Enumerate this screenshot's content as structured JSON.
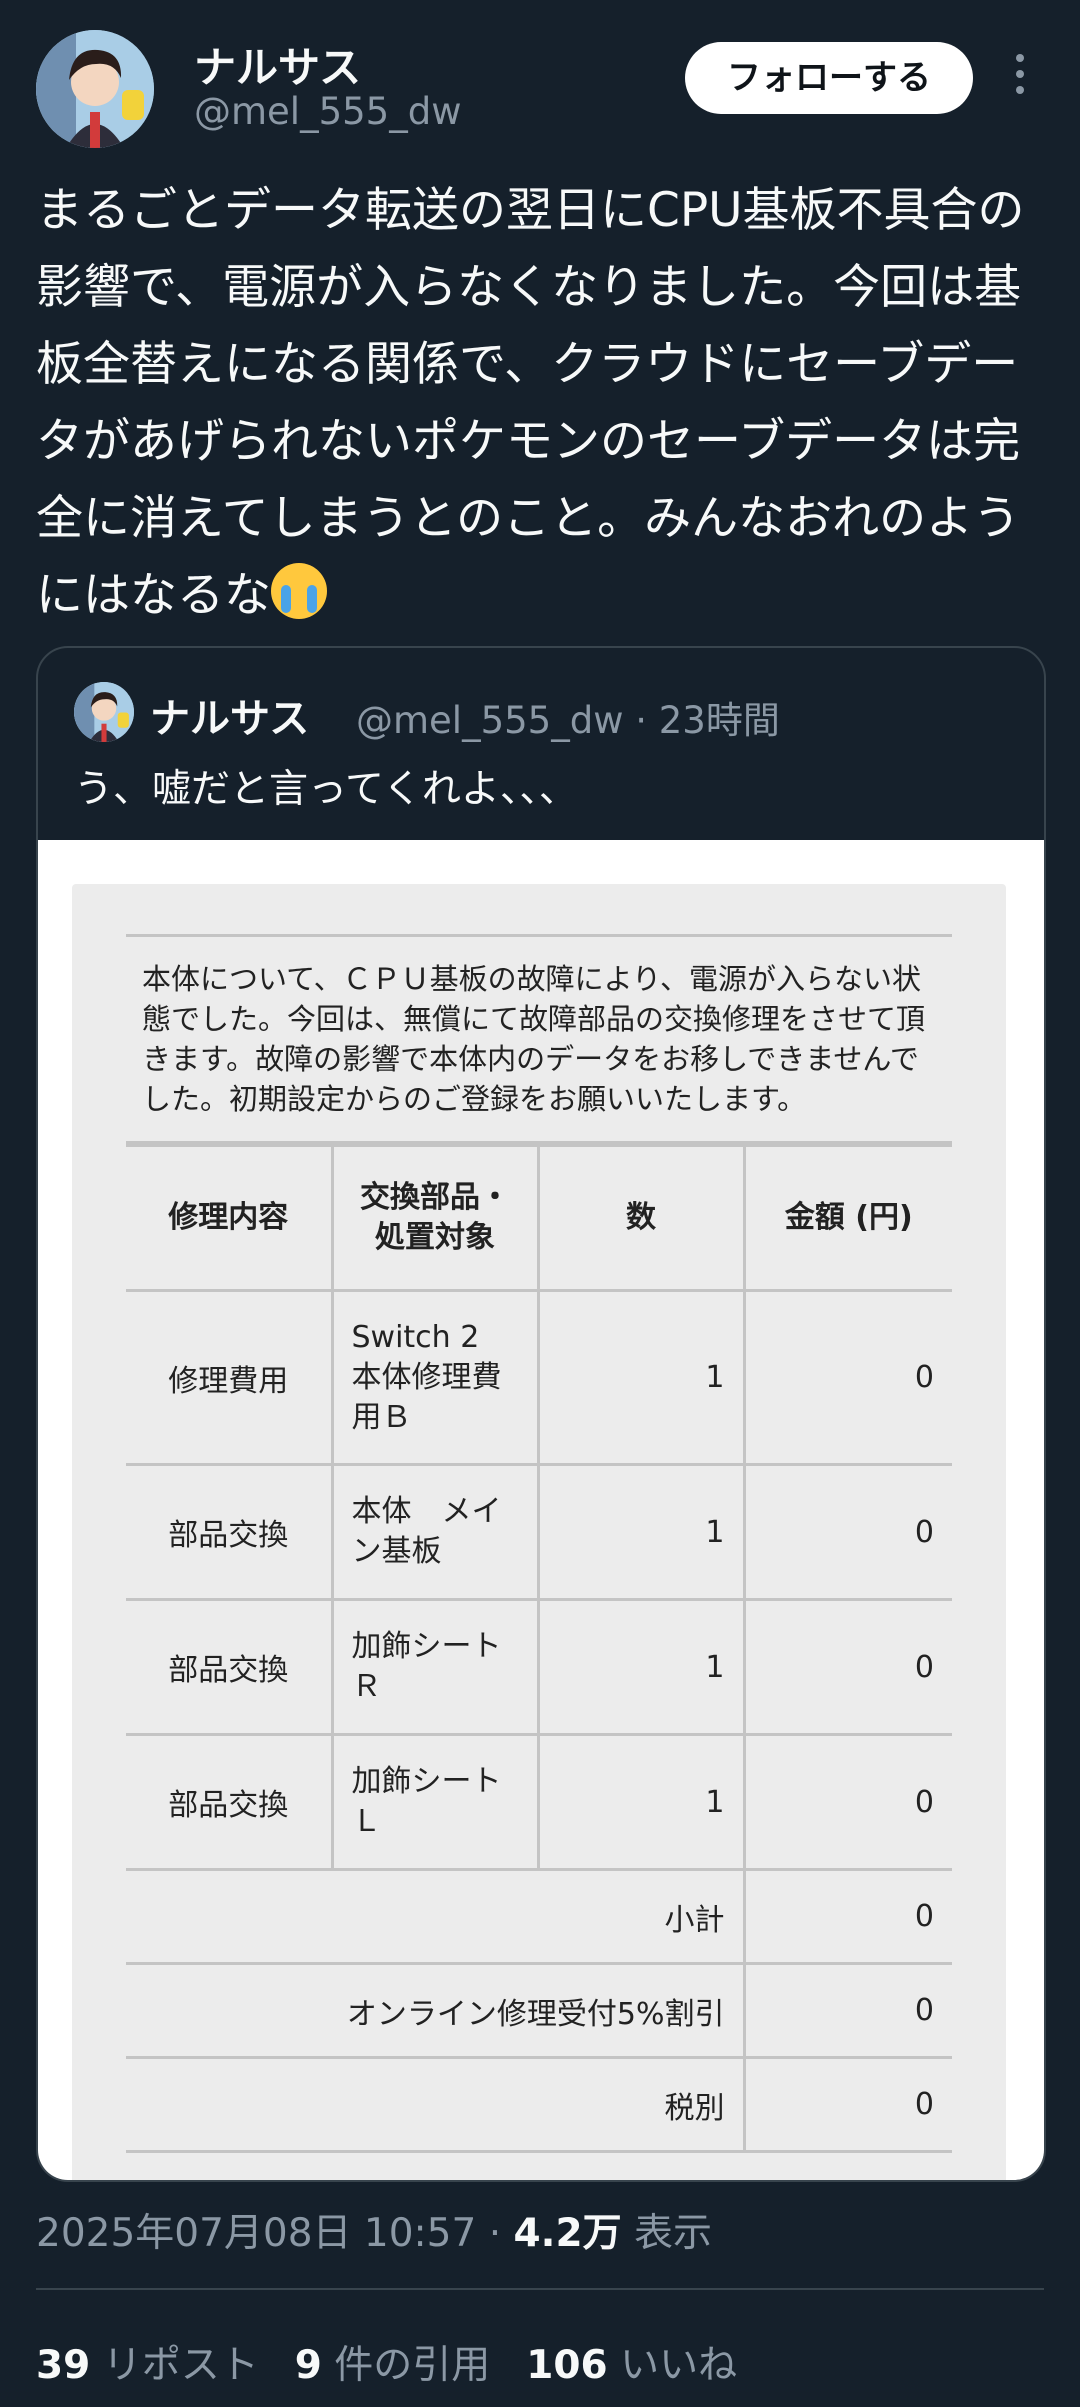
{
  "author": {
    "name": "ナルサス",
    "handle": "@mel_555_dw",
    "follow_label": "フォローする"
  },
  "tweet": {
    "text": "まるごとデータ転送の翌日にCPU基板不具合の影響で、電源が入らなくなりました。今回は基板全替えになる関係で、クラウドにセーブデータがあげられないポケモンのセーブデータは完全に消えてしまうとのこと。みんなおれのようにはなるな",
    "emoji": "loudly-crying-face"
  },
  "quote": {
    "name": "ナルサス",
    "handle_time": "@mel_555_dw · 23時間",
    "text": "う、嘘だと言ってくれよ、、、",
    "document": {
      "notice": "本体について、ＣＰＵ基板の故障により、電源が入らない状態でした。今回は、無償にて故障部品の交換修理をさせて頂きます。故障の影響で本体内のデータをお移しできませんでした。初期設定からのご登録をお願いいたします。",
      "headers": [
        "修理内容",
        "交換部品・処置対象",
        "数",
        "金額 (円)"
      ],
      "rows": [
        {
          "type": "修理費用",
          "part": "Switch 2 本体修理費用Ｂ",
          "qty": "1",
          "amount": "0"
        },
        {
          "type": "部品交換",
          "part": "本体　メイン基板",
          "qty": "1",
          "amount": "0"
        },
        {
          "type": "部品交換",
          "part": "加飾シートＲ",
          "qty": "1",
          "amount": "0"
        },
        {
          "type": "部品交換",
          "part": "加飾シートＬ",
          "qty": "1",
          "amount": "0"
        }
      ],
      "summary": [
        {
          "label": "小計",
          "amount": "0"
        },
        {
          "label": "オンライン修理受付5%割引",
          "amount": "0"
        },
        {
          "label": "税別",
          "amount": "0"
        }
      ]
    }
  },
  "meta": {
    "timestamp": "2025年07月08日 10:57 ·",
    "views": "4.2万",
    "views_label": "表示"
  },
  "stats": {
    "reposts": "39",
    "reposts_label": "リポスト",
    "quotes": "9",
    "quotes_label": "件の引用",
    "likes": "106",
    "likes_label": "いいね"
  }
}
